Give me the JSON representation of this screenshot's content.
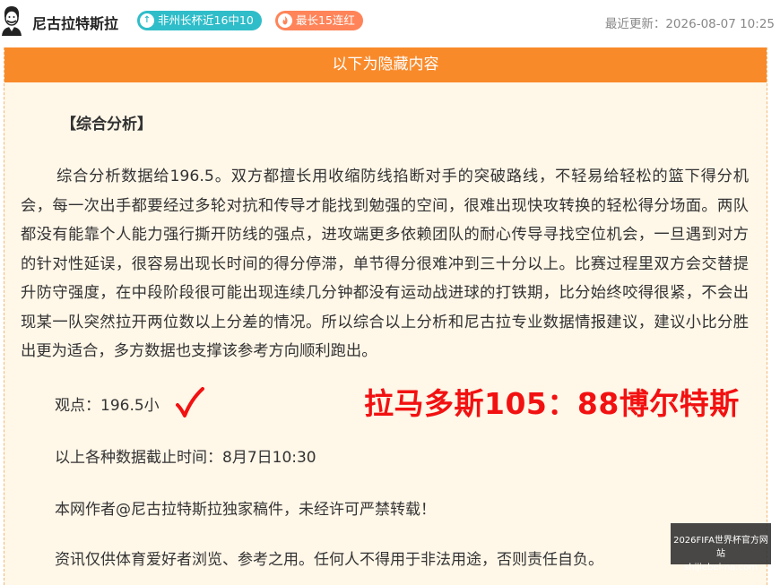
{
  "header": {
    "author_name": "尼古拉特斯拉",
    "badge_streak_recent": "非州长杯近16中10",
    "badge_streak_max": "最长15连红",
    "updated_label": "最近更新：",
    "updated_time": "2026-08-07 10:25"
  },
  "article": {
    "hidden_banner": "以下为隐藏内容",
    "section_title": "【综合分析】",
    "analysis": "综合分析数据给196.5。双方都擅长用收缩防线掐断对手的突破路线，不轻易给轻松的篮下得分机会，每一次出手都要经过多轮对抗和传导才能找到勉强的空间，很难出现快攻转换的轻松得分场面。两队都没有能靠个人能力强行撕开防线的强点，进攻端更多依赖团队的耐心传导寻找空位机会，一旦遇到对方的针对性延误，很容易出现长时间的得分停滞，单节得分很难冲到三十分以上。比赛过程里双方会交替提升防守强度，在中段阶段很可能出现连续几分钟都没有运动战进球的打铁期，比分始终咬得很紧，不会出现某一队突然拉开两位数以上分差的情况。所以综合以上分析和尼古拉专业数据情报建议，建议小比分胜出更为适合，多方数据也支撑该参考方向顺利跑出。",
    "viewpoint": "观点：196.5小",
    "final_score": "拉马多斯105：88博尔特斯",
    "data_cutoff": "以上各种数据截止时间：8月7日10:30",
    "copyright": "本网作者@尼古拉特斯拉独家稿件，未经许可严禁转载！",
    "disclaimer": "资讯仅供体育爱好者浏览、参考之用。任何人不得用于非法用途，否则责任自负。"
  },
  "watermark": {
    "line1": "2026FIFA世界杯官方网站",
    "line2": "shijiebei-na.com"
  },
  "colors": {
    "banner": "#f98a2a",
    "badge_teal": "#2fbdc9",
    "badge_orange": "#ff8459",
    "highlight_red": "#f21111",
    "box_bg": "#fff7e8"
  },
  "icons": {
    "badge_recent": "up-arrow-icon",
    "badge_max": "flame-icon",
    "viewpoint_mark": "checkmark-icon"
  }
}
